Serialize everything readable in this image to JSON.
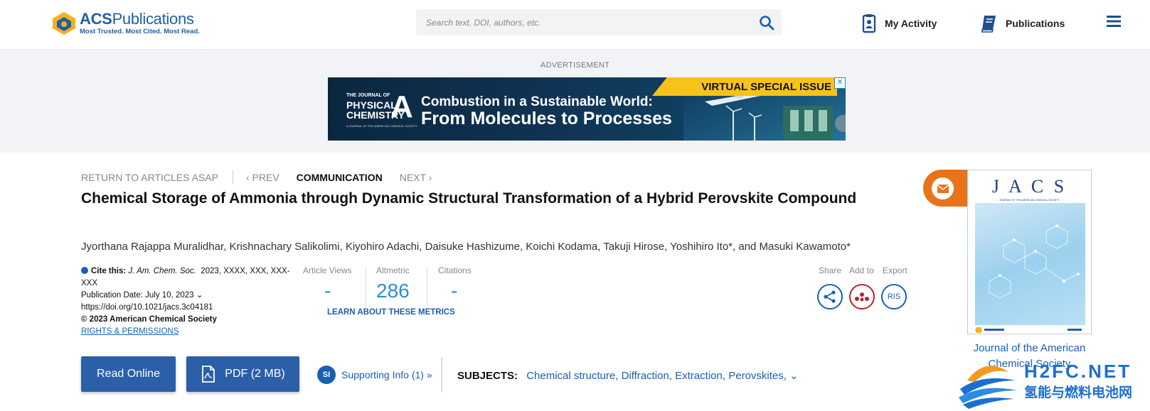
{
  "header": {
    "logo_title_bold": "ACS",
    "logo_title_rest": "Publications",
    "logo_tagline": "Most Trusted. Most Cited. Most Read.",
    "search_placeholder": "Search text, DOI, authors, etc.",
    "my_activity": "My Activity",
    "publications": "Publications"
  },
  "ad": {
    "label": "ADVERTISEMENT",
    "journal_small": "THE JOURNAL OF",
    "journal_line1": "PHYSICAL",
    "journal_line2": "CHEMISTRY",
    "journal_letter": "A",
    "journal_tiny": "A JOURNAL OF THE AMERICAN CHEMICAL SOCIETY",
    "tag": "VIRTUAL SPECIAL ISSUE",
    "line1": "Combustion in a Sustainable World:",
    "line2": "From Molecules to Processes",
    "close": "✕"
  },
  "article_nav": {
    "return": "RETURN TO ARTICLES ASAP",
    "prev": "‹ PREV",
    "type": "COMMUNICATION",
    "next": "NEXT ›"
  },
  "article": {
    "title": "Chemical Storage of Ammonia through Dynamic Structural Transformation of a Hybrid Perovskite Compound",
    "authors": "Jyorthana Rajappa Muralidhar, Krishnachary Salikolimi, Kiyohiro Adachi, Daisuke Hashizume, Koichi Kodama, Takuji Hirose, Yoshihiro Ito*, and Masuki Kawamoto*"
  },
  "cite": {
    "label": "Cite this:",
    "journal": "J. Am. Chem. Soc.",
    "ref": "2023, XXXX, XXX, XXX-",
    "ref_cont": "XXX",
    "pub_date": "Publication Date: July 10, 2023",
    "doi": "https://doi.org/10.1021/jacs.3c04181",
    "copyright": "© 2023 American Chemical Society",
    "rights": "RIGHTS & PERMISSIONS"
  },
  "metrics": {
    "views_label": "Article Views",
    "views_value": "-",
    "altmetric_label": "Altmetric",
    "altmetric_value": "286",
    "citations_label": "Citations",
    "citations_value": "-",
    "learn": "LEARN ABOUT THESE METRICS"
  },
  "tools": {
    "share": "Share",
    "add_to": "Add to",
    "export": "Export",
    "ris": "RIS"
  },
  "actions": {
    "read_online": "Read Online",
    "pdf": "PDF (2 MB)",
    "si_badge": "SI",
    "supporting_info": "Supporting Info (1) »"
  },
  "subjects": {
    "label": "SUBJECTS:",
    "items": [
      "Chemical structure,",
      "Diffraction,",
      "Extraction,",
      "Perovskites,"
    ]
  },
  "sidebar": {
    "cover_title": "J A C S",
    "cover_subtitle": "JOURNAL OF THE AMERICAN CHEMICAL SOCIETY",
    "journal_name": "Journal of the American Chemical Society"
  },
  "watermark": {
    "en": "H2FC.NET",
    "cn": "氢能与燃料电池网"
  },
  "colors": {
    "brand_blue": "#1a5fb4",
    "button_blue": "#2b5fa8",
    "metric_blue": "#2b8fd4",
    "email_orange": "#e8731a",
    "ad_yellow": "#f7c21a"
  }
}
